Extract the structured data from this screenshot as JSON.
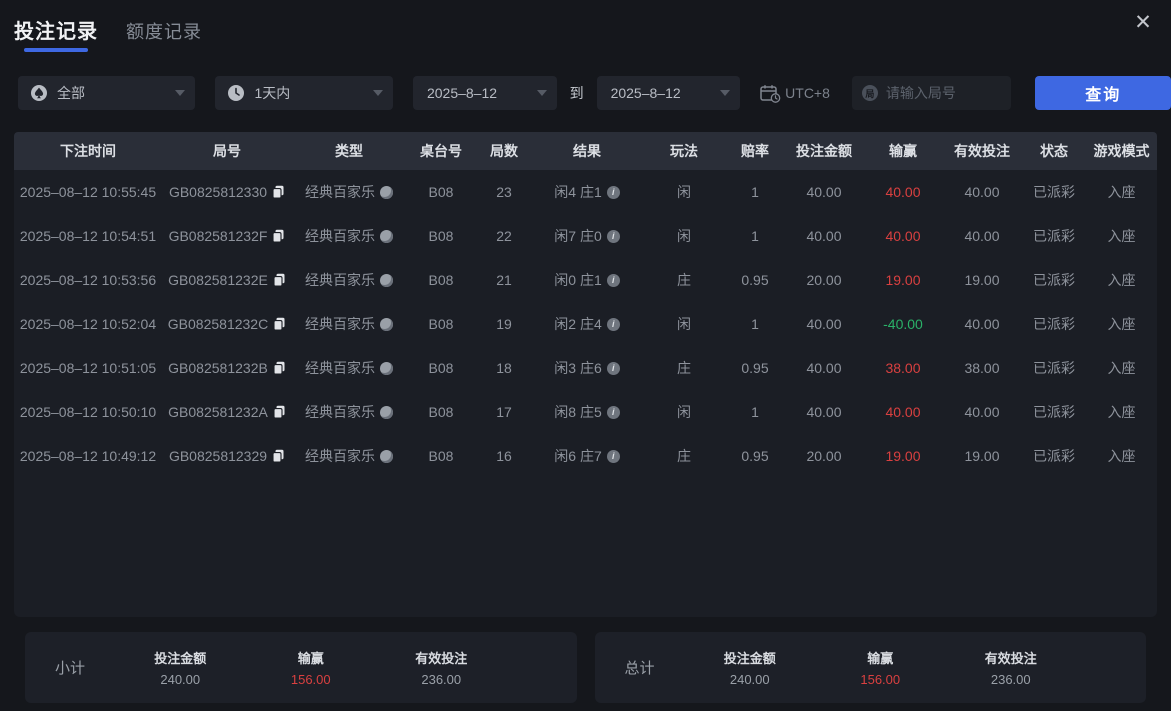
{
  "colors": {
    "accent": "#3e68e2",
    "win_red": "#d94040",
    "loss_green": "#2ab168",
    "page_bg": "#15171c"
  },
  "window": {
    "close_icon": "✕"
  },
  "tabs": [
    {
      "label": "投注记录",
      "active": true
    },
    {
      "label": "额度记录",
      "active": false
    }
  ],
  "filters": {
    "game_type_value": "全部",
    "time_range_value": "1天内",
    "date_from": "2025–8–12",
    "to_label": "到",
    "date_to": "2025–8–12",
    "timezone": "UTC+8",
    "round_placeholder": "请输入局号",
    "round_badge": "局",
    "query_label": "查询"
  },
  "table": {
    "headers": [
      "下注时间",
      "局号",
      "类型",
      "桌台号",
      "局数",
      "结果",
      "玩法",
      "赔率",
      "投注金额",
      "输赢",
      "有效投注",
      "状态",
      "游戏模式"
    ],
    "rows": [
      {
        "time": "2025–08–12 10:55:45",
        "round_id": "GB0825812330",
        "type": "经典百家乐",
        "table_no": "B08",
        "round_no": "23",
        "result": "闲4 庄1",
        "play": "闲",
        "odds": "1",
        "bet": "40.00",
        "win_loss": "40.00",
        "win_loss_color": "red",
        "valid_bet": "40.00",
        "status": "已派彩",
        "mode": "入座"
      },
      {
        "time": "2025–08–12 10:54:51",
        "round_id": "GB082581232F",
        "type": "经典百家乐",
        "table_no": "B08",
        "round_no": "22",
        "result": "闲7 庄0",
        "play": "闲",
        "odds": "1",
        "bet": "40.00",
        "win_loss": "40.00",
        "win_loss_color": "red",
        "valid_bet": "40.00",
        "status": "已派彩",
        "mode": "入座"
      },
      {
        "time": "2025–08–12 10:53:56",
        "round_id": "GB082581232E",
        "type": "经典百家乐",
        "table_no": "B08",
        "round_no": "21",
        "result": "闲0 庄1",
        "play": "庄",
        "odds": "0.95",
        "bet": "20.00",
        "win_loss": "19.00",
        "win_loss_color": "red",
        "valid_bet": "19.00",
        "status": "已派彩",
        "mode": "入座"
      },
      {
        "time": "2025–08–12 10:52:04",
        "round_id": "GB082581232C",
        "type": "经典百家乐",
        "table_no": "B08",
        "round_no": "19",
        "result": "闲2 庄4",
        "play": "闲",
        "odds": "1",
        "bet": "40.00",
        "win_loss": "-40.00",
        "win_loss_color": "green",
        "valid_bet": "40.00",
        "status": "已派彩",
        "mode": "入座"
      },
      {
        "time": "2025–08–12 10:51:05",
        "round_id": "GB082581232B",
        "type": "经典百家乐",
        "table_no": "B08",
        "round_no": "18",
        "result": "闲3 庄6",
        "play": "庄",
        "odds": "0.95",
        "bet": "40.00",
        "win_loss": "38.00",
        "win_loss_color": "red",
        "valid_bet": "38.00",
        "status": "已派彩",
        "mode": "入座"
      },
      {
        "time": "2025–08–12 10:50:10",
        "round_id": "GB082581232A",
        "type": "经典百家乐",
        "table_no": "B08",
        "round_no": "17",
        "result": "闲8 庄5",
        "play": "闲",
        "odds": "1",
        "bet": "40.00",
        "win_loss": "40.00",
        "win_loss_color": "red",
        "valid_bet": "40.00",
        "status": "已派彩",
        "mode": "入座"
      },
      {
        "time": "2025–08–12 10:49:12",
        "round_id": "GB0825812329",
        "type": "经典百家乐",
        "table_no": "B08",
        "round_no": "16",
        "result": "闲6 庄7",
        "play": "庄",
        "odds": "0.95",
        "bet": "20.00",
        "win_loss": "19.00",
        "win_loss_color": "red",
        "valid_bet": "19.00",
        "status": "已派彩",
        "mode": "入座"
      }
    ]
  },
  "summary": {
    "subtotal": {
      "label": "小计",
      "bet_label": "投注金额",
      "bet_value": "240.00",
      "win_label": "输赢",
      "win_value": "156.00",
      "valid_label": "有效投注",
      "valid_value": "236.00"
    },
    "total": {
      "label": "总计",
      "bet_label": "投注金额",
      "bet_value": "240.00",
      "win_label": "输赢",
      "win_value": "156.00",
      "valid_label": "有效投注",
      "valid_value": "236.00"
    }
  }
}
